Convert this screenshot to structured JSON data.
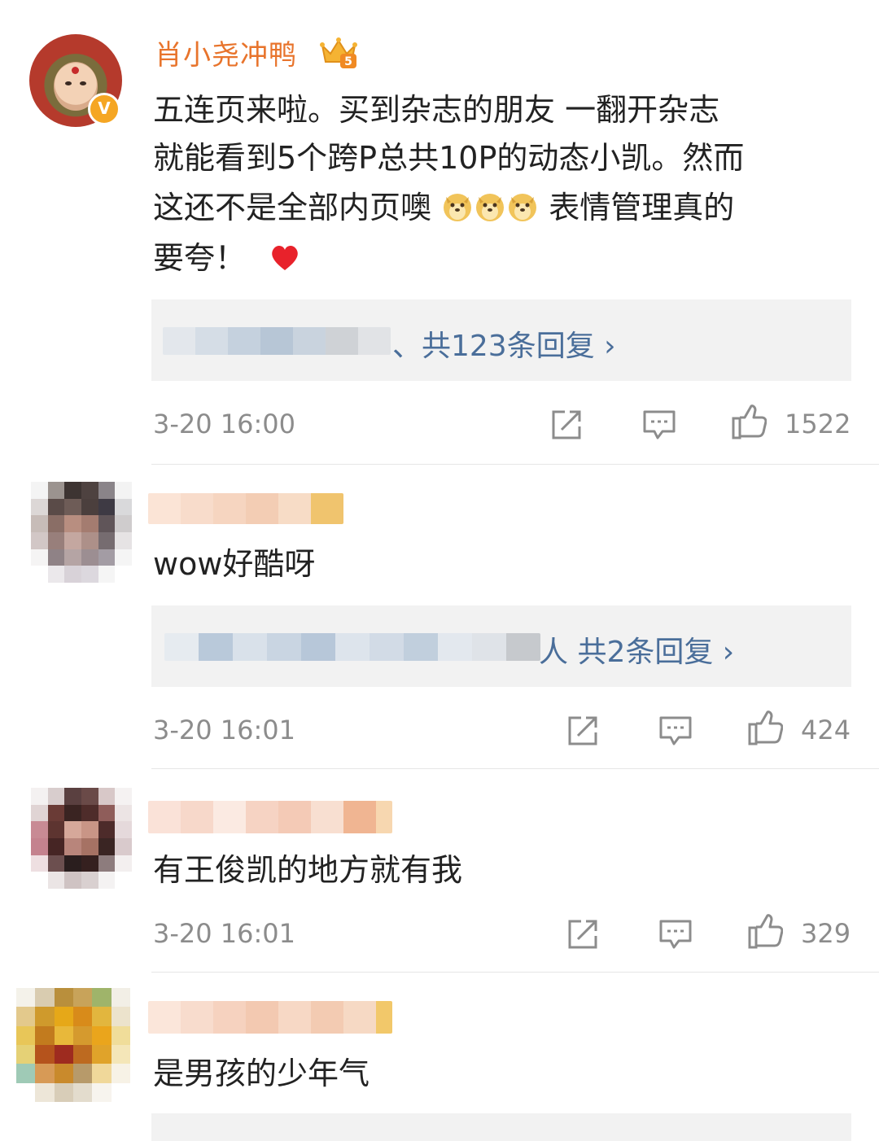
{
  "comments": [
    {
      "username": "肖小尧冲鸭",
      "text_lines": [
        "五连页来啦。买到杂志的朋友 一翻开杂志",
        "就能看到5个跨P总共10P的动态小凯。然而",
        "这还不是全部内页噢",
        "表情管理真的",
        "要夸！"
      ],
      "reply_summary": "、共123条回复 ›",
      "time": "3-20 16:00",
      "likes": "1522"
    },
    {
      "text": "wow好酷呀",
      "reply_summary": "人 共2条回复 ›",
      "time": "3-20 16:01",
      "likes": "424"
    },
    {
      "text": "有王俊凯的地方就有我",
      "time": "3-20 16:01",
      "likes": "329"
    },
    {
      "text": "是男孩的少年气"
    }
  ],
  "badges": {
    "verified": "V",
    "crown_level": "5"
  },
  "icons": {
    "share": "share-icon",
    "comment": "comment-icon",
    "like": "thumbs-up-icon",
    "emoji_dog": "doge-emoji",
    "heart": "heart-emoji"
  },
  "colors": {
    "username": "#e8742c",
    "link": "#4a6e9a",
    "meta": "#8c8c8c",
    "reply_bg": "#f2f2f2"
  }
}
